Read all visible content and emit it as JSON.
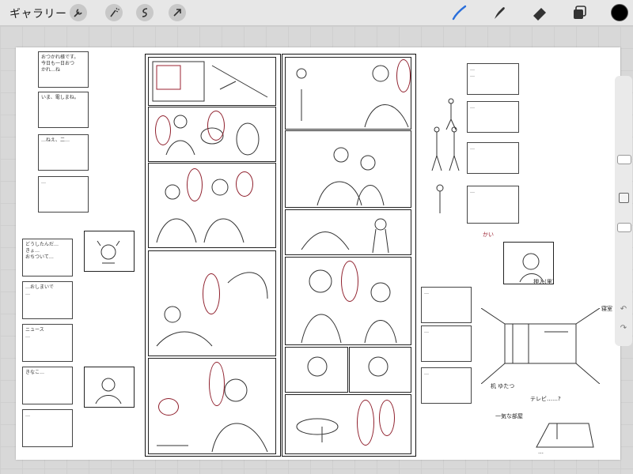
{
  "toolbar": {
    "gallery_label": "ギャラリー",
    "left_tools": [
      "wrench-icon",
      "magic-wand-icon",
      "selection-icon",
      "transform-arrow-icon"
    ],
    "right_tools": [
      "brush-icon",
      "smudge-icon",
      "eraser-icon",
      "layers-icon"
    ],
    "active_tool": "brush-icon",
    "active_color": "#000000",
    "brush_accent": "#2a6fdb"
  },
  "canvas": {
    "background": "#ffffff",
    "sketch_ink": "#1a1a1a",
    "annotation_ink": "#9b2030"
  },
  "notes_left": [
    {
      "text": "おつかれ様です。\n今日も一日おつ\nかれ…ね"
    },
    {
      "text": "いま、電しまね。"
    },
    {
      "text": "…ねえ、二…"
    },
    {
      "text": "…"
    },
    {
      "text": "どうしたんだ…\nきょ…\nおちついて…"
    },
    {
      "text": "…おしまいで\n…"
    },
    {
      "text": "ニュース\n…"
    },
    {
      "text": "きなこ…"
    },
    {
      "text": "…"
    }
  ],
  "notes_right": [
    {
      "text": "…\n…"
    },
    {
      "text": "…"
    },
    {
      "text": "…"
    },
    {
      "text": "…"
    }
  ],
  "notes_center_right": [
    {
      "text": "…"
    },
    {
      "text": "…"
    },
    {
      "text": "…"
    }
  ],
  "room_labels": {
    "oshiire": "押入(里)",
    "bedroom": "寝室",
    "tsukue": "机 ゆたつ",
    "terebi": "テレビ……?",
    "note_ippai": "一気な部屋",
    "note_bottom": "…",
    "kaigi": "かい"
  },
  "sidebar": {
    "undo_icon": "undo-icon",
    "redo_icon": "redo-icon"
  }
}
